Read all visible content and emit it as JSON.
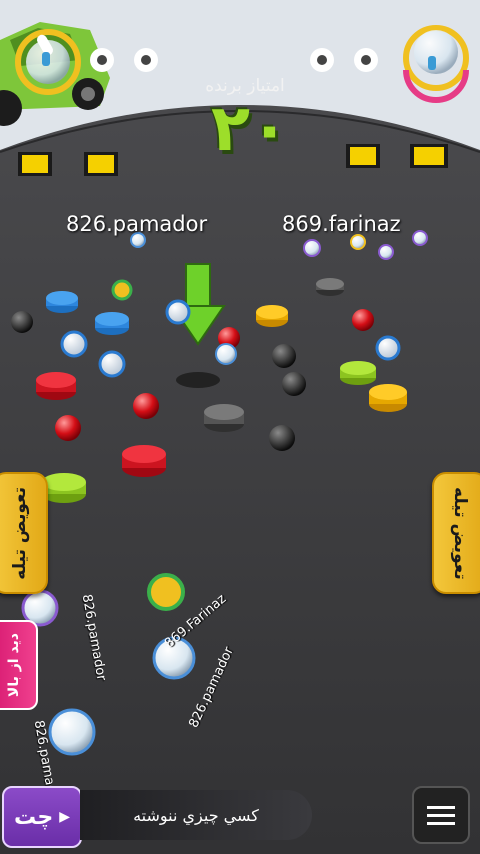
{
  "header": {
    "score_title": "امتیاز برنده",
    "score_value": "۲۰"
  },
  "players": {
    "player1": "826.pamador",
    "player2": "869.farinaz"
  },
  "floor_labels": {
    "l1": "826.pamador",
    "l2": "869.Farinaz",
    "l3": "826.pamador",
    "l4": "826.pamador"
  },
  "controls": {
    "swap_left": "تعویض تیله",
    "swap_right": "تعویض تیله",
    "view_top": "دید از بالا",
    "chat_label": "چت",
    "chat_placeholder": "كسي چيزي ننوشته"
  },
  "colors": {
    "floor": "#3a3a3c",
    "accent_green": "#9dde2a",
    "yellow_marker": "#f5d000",
    "chat_purple": "#7a3bb8",
    "view_pink": "#e02a80"
  }
}
